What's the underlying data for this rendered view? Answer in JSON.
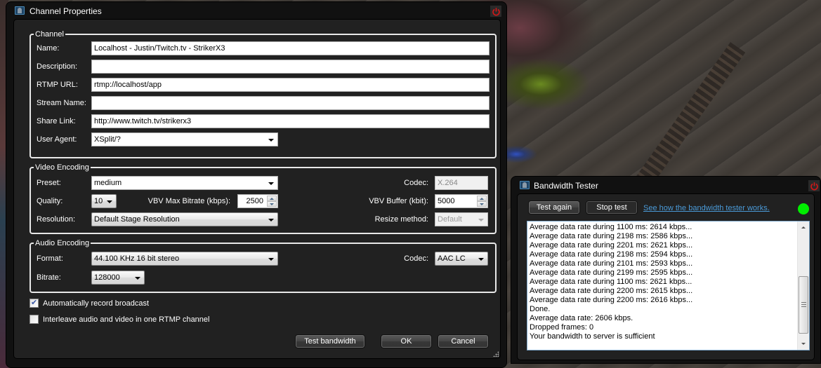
{
  "channel_window": {
    "title": "Channel Properties",
    "channel_group": {
      "legend": "Channel",
      "name_label": "Name:",
      "name_value": "Localhost - Justin/Twitch.tv - StrikerX3",
      "description_label": "Description:",
      "description_value": "",
      "rtmp_url_label": "RTMP URL:",
      "rtmp_url_value": "rtmp://localhost/app",
      "stream_name_label": "Stream Name:",
      "stream_name_value": "",
      "share_link_label": "Share Link:",
      "share_link_value": "http://www.twitch.tv/strikerx3",
      "user_agent_label": "User Agent:",
      "user_agent_value": "XSplit/?"
    },
    "video_group": {
      "legend": "Video Encoding",
      "preset_label": "Preset:",
      "preset_value": "medium",
      "codec_label": "Codec:",
      "codec_value": "X.264",
      "quality_label": "Quality:",
      "quality_value": "10",
      "vbv_max_label": "VBV Max Bitrate (kbps):",
      "vbv_max_value": "2500",
      "vbv_buffer_label": "VBV Buffer (kbit):",
      "vbv_buffer_value": "5000",
      "resolution_label": "Resolution:",
      "resolution_value": "Default Stage Resolution",
      "resize_label": "Resize method:",
      "resize_value": "Default"
    },
    "audio_group": {
      "legend": "Audio Encoding",
      "format_label": "Format:",
      "format_value": "44.100 KHz 16 bit stereo",
      "codec_label": "Codec:",
      "codec_value": "AAC LC",
      "bitrate_label": "Bitrate:",
      "bitrate_value": "128000"
    },
    "options": [
      {
        "label": "Automatically record broadcast",
        "checked": true
      },
      {
        "label": "Interleave audio and video in one RTMP channel",
        "checked": false
      }
    ],
    "buttons": {
      "test_bandwidth": "Test bandwidth",
      "ok": "OK",
      "cancel": "Cancel"
    }
  },
  "bandwidth_window": {
    "title": "Bandwidth Tester",
    "test_again_label": "Test again",
    "stop_test_label": "Stop test",
    "help_link": "See how the bandwidth tester works.",
    "status_color": "#00ee00",
    "log_lines": [
      "Average data rate during 1100 ms: 2614 kbps...",
      "Average data rate during 2198 ms: 2586 kbps...",
      "Average data rate during 2201 ms: 2621 kbps...",
      "Average data rate during 2198 ms: 2594 kbps...",
      "Average data rate during 2101 ms: 2593 kbps...",
      "Average data rate during 2199 ms: 2595 kbps...",
      "Average data rate during 1100 ms: 2621 kbps...",
      "Average data rate during 2200 ms: 2615 kbps...",
      "Average data rate during 2200 ms: 2616 kbps...",
      "Done.",
      "Average data rate: 2606 kbps.",
      "Dropped frames: 0",
      "Your bandwidth to server is sufficient"
    ]
  }
}
